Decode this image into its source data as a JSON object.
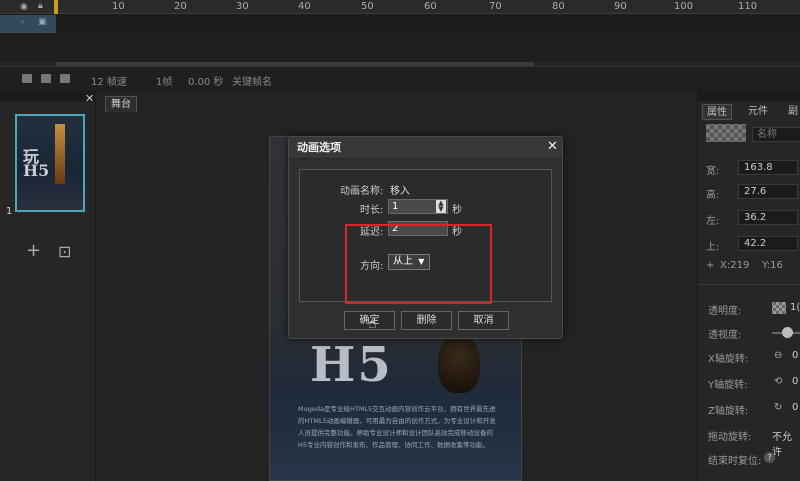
{
  "timeline": {
    "ruler_ticks": [
      "10",
      "20",
      "30",
      "40",
      "50",
      "60",
      "70",
      "80",
      "90",
      "100",
      "110"
    ],
    "fps_label": "12 帧速",
    "frame_label": "1帧",
    "time_label": "0.00 秒",
    "keyframe_label": "关键帧名"
  },
  "left_panel": {
    "page_number": "1",
    "add_page": "+",
    "add_page2": "⊡"
  },
  "stage": {
    "tab_label": "舞台",
    "close_label": "✕",
    "poster_big": "H5",
    "poster_text": "Mugeda是专业级HTML5交互动画内容创作云平台，拥有世界最先进的HTML5动画编辑器，可用最为自由的创作方式，为专业设计和开发人员提供完整功能。帮助专业设计师和设计团队高效完成移动设备的H5专业内容创作和发布、作品管理、协同工作、数据收集等功能。"
  },
  "right_panel": {
    "tabs": [
      "属性",
      "元件",
      "副"
    ],
    "name_placeholder": "名称",
    "width_label": "宽:",
    "width_value": "163.8",
    "height_label": "高:",
    "height_value": "27.6",
    "left_label": "左:",
    "left_value": "36.2",
    "top_label": "上:",
    "top_value": "42.2",
    "x_label": "X:219",
    "y_label": "Y:16",
    "opacity_label": "透明度:",
    "opacity_value": "1(",
    "perspective_label": "透视度:",
    "x_rotate_label": "X轴旋转:",
    "y_rotate_label": "Y轴旋转:",
    "z_rotate_label": "Z轴旋转:",
    "drag_rotate_label": "拖动旋转:",
    "drag_rotate_value": "不允许",
    "reset_label": "结束时复位:",
    "help_label": "?",
    "rot_x_value": "0",
    "rot_y_value": "0",
    "rot_z_value": "0"
  },
  "dialog": {
    "title": "动画选项",
    "close": "✕",
    "anim_name_label": "动画名称:",
    "anim_name_value": "移入",
    "duration_label": "时长:",
    "duration_value": "1",
    "duration_unit": "秒",
    "delay_label": "延迟:",
    "delay_value": "2",
    "delay_unit": "秒",
    "direction_label": "方向:",
    "direction_value": "从上",
    "confirm_label": "确定",
    "delete_label": "删除",
    "cancel_label": "取消"
  },
  "colors": {
    "highlight": "#d8252a",
    "selection": "#4aa8b8",
    "playhead": "#c8a020"
  }
}
